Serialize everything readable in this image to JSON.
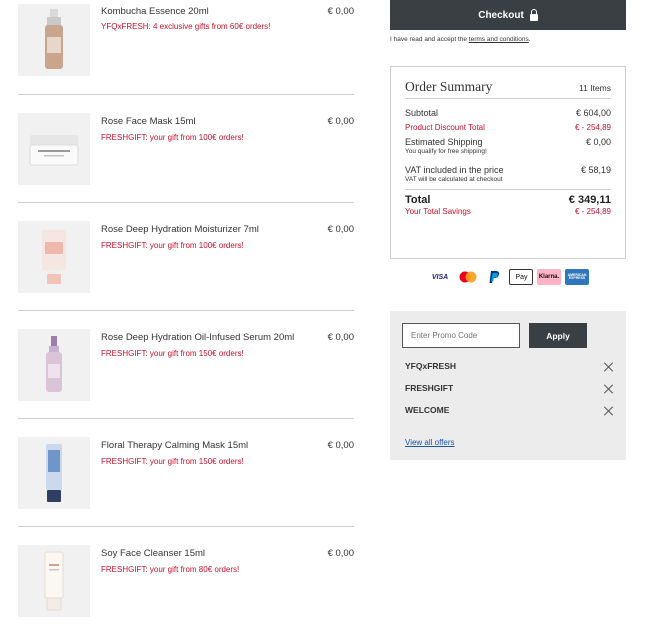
{
  "cart": {
    "items": [
      {
        "name": "Kombucha Essence 20ml",
        "promo": "YFQxFRESH: 4 exclusive gifts from 60€ orders!",
        "price": "€ 0,00",
        "image": "amber-bottle"
      },
      {
        "name": "Rose Face Mask 15ml",
        "promo": "FRESHGIFT: your gift from 100€ orders!",
        "price": "€ 0,00",
        "image": "white-jar"
      },
      {
        "name": "Rose Deep Hydration Moisturizer 7ml",
        "promo": "FRESHGIFT: your gift from 100€ orders!",
        "price": "€ 0,00",
        "image": "pink-tube"
      },
      {
        "name": "Rose Deep Hydration Oil-Infused Serum 20ml",
        "promo": "FRESHGIFT: your gift from 150€ orders!",
        "price": "€ 0,00",
        "image": "pink-bottle"
      },
      {
        "name": "Floral Therapy Calming Mask 15ml",
        "promo": "FRESHGIFT: your gift from 150€ orders!",
        "price": "€ 0,00",
        "image": "blue-tube"
      },
      {
        "name": "Soy Face Cleanser 15ml",
        "promo": "FRESHGIFT: your gift from 80€ orders!",
        "price": "€ 0,00",
        "image": "white-tube"
      }
    ]
  },
  "checkout": {
    "button_label": "Checkout",
    "icon": "lock-icon",
    "terms_prefix": "I have read and accept the ",
    "terms_link": "terms and conditions",
    "terms_suffix": "."
  },
  "summary": {
    "title": "Order Summary",
    "item_count": "11 Items",
    "subtotal_label": "Subtotal",
    "subtotal_value": "€ 604,00",
    "discount_label": "Product Discount Total",
    "discount_value": "€ - 254,89",
    "shipping_label": "Estimated Shipping",
    "shipping_value": "€ 0,00",
    "shipping_note": "You qualify for free shipping!",
    "vat_label": "VAT included in the price",
    "vat_value": "€ 58,19",
    "vat_note": "VAT will be calculated at checkout",
    "total_label": "Total",
    "total_value": "€ 349,11",
    "savings_label": "Your Total Savings",
    "savings_value": "€ - 254,89"
  },
  "payments": [
    "VISA",
    "Mastercard",
    "PayPal",
    "Pay",
    "Klarna.",
    "AMERICAN EXPRESS"
  ],
  "promo": {
    "placeholder": "Enter Promo Code",
    "apply_label": "Apply",
    "applied_codes": [
      "YFQxFRESH",
      "FRESHGIFT",
      "WELCOME"
    ],
    "view_all": "View all offers"
  },
  "colors": {
    "accent_dark": "#3a3f44",
    "promo_red": "#c8102e",
    "link_blue": "#1a55a8"
  }
}
